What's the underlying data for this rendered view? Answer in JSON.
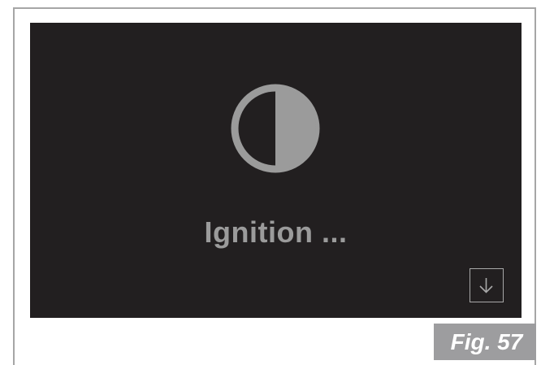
{
  "display": {
    "status_text": "Ignition ...",
    "status_icon": "half-filled-circle-icon",
    "background_color": "#221f20",
    "foreground_color": "#9b9b9b",
    "down_button_icon": "arrow-down-icon"
  },
  "figure": {
    "label": "Fig. 57",
    "label_background": "#9d9d9f"
  }
}
